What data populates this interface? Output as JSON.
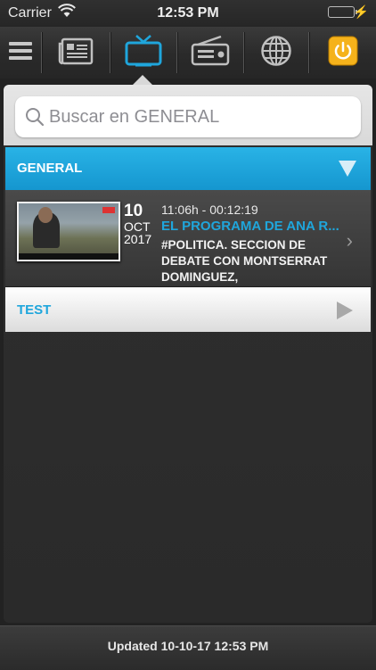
{
  "status_bar": {
    "carrier": "Carrier",
    "time": "12:53 PM"
  },
  "toolbar": {
    "buttons": [
      {
        "icon": "menu-icon"
      },
      {
        "icon": "newspaper-icon"
      },
      {
        "icon": "tv-icon",
        "selected": true
      },
      {
        "icon": "radio-icon"
      },
      {
        "icon": "globe-icon"
      },
      {
        "icon": "power-icon"
      }
    ],
    "accent_color": "#1fa6dc",
    "power_color": "#f5b21b"
  },
  "search": {
    "placeholder": "Buscar en GENERAL"
  },
  "categories": [
    {
      "label": "GENERAL",
      "expanded": true,
      "items": [
        {
          "day": "10",
          "month": "OCT",
          "year": "2017",
          "time_range": "11:06h - 00:12:19",
          "title": "EL PROGRAMA DE ANA R...",
          "description": "#POLITICA. SECCION DE DEBATE CON MONTSERRAT DOMINGUEZ,"
        }
      ]
    },
    {
      "label": "TEST",
      "expanded": false
    }
  ],
  "footer": {
    "updated_text": "Updated 10-10-17 12:53 PM"
  }
}
